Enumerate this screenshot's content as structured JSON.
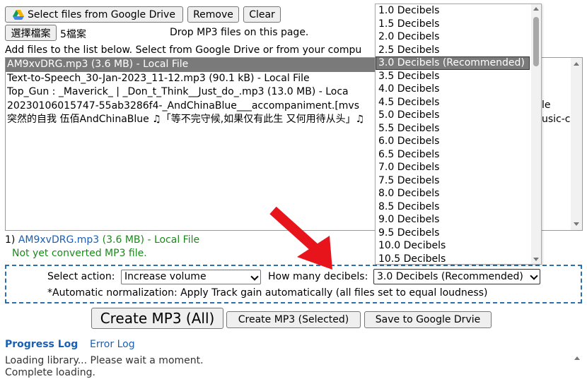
{
  "toolbar": {
    "gdrive_button": "Select files from Google Drive",
    "remove_button": "Remove",
    "clear_button": "Clear",
    "choose_file_button": "選擇檔案",
    "file_count": "5檔案",
    "drop_hint": "Drop MP3 files on this page."
  },
  "instructions": "Add files to the list below. Select from Google Drive or from your compu",
  "files": [
    "AM9xvDRG.mp3 (3.6 MB) - Local File",
    "Text-to-Speech_30-Jan-2023_11-12.mp3 (90.1 kB) - Local File",
    "Top_Gun : _Maverick_ | _Don_t_Think__Just_do_.mp3 (13.0 MB) - Loca",
    "20230106015747-55ab3286f4-_AndChinaBlue___accompaniment.[mvs",
    "突然的自我 伍佰AndChinaBlue ♫「等不完守候,如果仅有此生 又何用待从头」♫"
  ],
  "files_overflow_right": [
    "le",
    "usic-cl"
  ],
  "selected_file": {
    "index": "1)",
    "name": "AM9xvDRG.mp3",
    "size": "(3.6 MB)",
    "source": "- Local File",
    "status": "Not yet converted MP3 file."
  },
  "actions": {
    "select_action_label": "Select action:",
    "select_action_value": "Increase volume",
    "decibels_label": "How many decibels:",
    "decibels_value": "3.0 Decibels (Recommended)",
    "normalization_note": "*Automatic normalization: Apply Track gain automatically (all files set to equal loudness)"
  },
  "buttons": {
    "create_all": "Create MP3 (All)",
    "create_selected": "Create MP3 (Selected)",
    "save_drive": "Save to Google Drvie"
  },
  "logs": {
    "progress_tab": "Progress Log",
    "error_tab": "Error Log",
    "line1": "Loading library... Please wait a moment.",
    "line2": "Complete loading."
  },
  "decibel_options": [
    "1.0 Decibels",
    "1.5 Decibels",
    "2.0 Decibels",
    "2.5 Decibels",
    "3.0 Decibels (Recommended)",
    "3.5 Decibels",
    "4.0 Decibels",
    "4.5 Decibels",
    "5.0 Decibels",
    "5.5 Decibels",
    "6.0 Decibels",
    "6.5 Decibels",
    "7.0 Decibels",
    "7.5 Decibels",
    "8.0 Decibels",
    "8.5 Decibels",
    "9.0 Decibels",
    "9.5 Decibels",
    "10.0 Decibels",
    "10.5 Decibels"
  ],
  "icons": {
    "gdrive": "google-drive-icon",
    "arrow": "red-arrow-annotation"
  },
  "colors": {
    "link": "#1a5fb4",
    "status_green": "#1a8a1a",
    "selected_bg": "#7a7a7a",
    "dashed_border": "#2a6fb0",
    "annotation_red": "#e8141c"
  }
}
